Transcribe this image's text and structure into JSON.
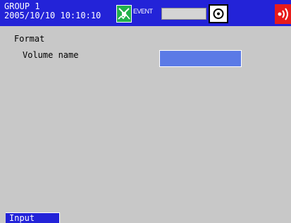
{
  "status_bar": {
    "group": "GROUP 1",
    "datetime": "2005/10/10 10:10:10",
    "event_label": "EVENT",
    "icons": {
      "event": "event-status-icon",
      "media": "media-drive-icon",
      "alarm": "alarm-sound-icon"
    },
    "colors": {
      "bar": "#2323d8",
      "event_icon": "#22b14c",
      "alarm": "#e81b1b"
    }
  },
  "form": {
    "title": "Format",
    "volume_name_label": "Volume name",
    "volume_name_value": "",
    "input_color": "#5b7ae6"
  },
  "softkeys": [
    {
      "label": "Input"
    }
  ]
}
